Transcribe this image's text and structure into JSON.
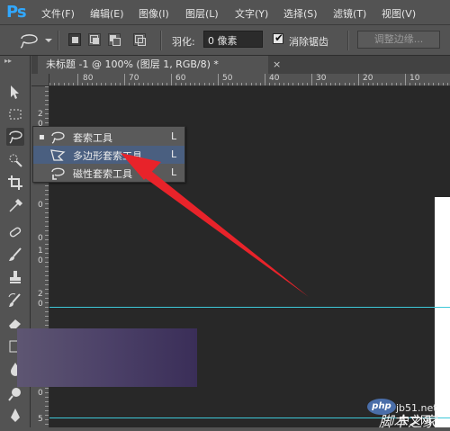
{
  "app": {
    "logo": "Ps"
  },
  "menu": [
    {
      "label": "文件(F)"
    },
    {
      "label": "编辑(E)"
    },
    {
      "label": "图像(I)"
    },
    {
      "label": "图层(L)"
    },
    {
      "label": "文字(Y)"
    },
    {
      "label": "选择(S)"
    },
    {
      "label": "滤镜(T)"
    },
    {
      "label": "视图(V)"
    }
  ],
  "options": {
    "feather_label": "羽化:",
    "feather_value": "0 像素",
    "antialias_label": "消除锯齿",
    "antialias_checked": true,
    "refine_label": "调整边缘...",
    "check_mark": "✔"
  },
  "document": {
    "tab_title": "未标题 -1 @ 100% (图层 1, RGB/8) *",
    "close_glyph": "×"
  },
  "ruler": {
    "top_labels": [
      "80",
      "70",
      "60",
      "50",
      "40",
      "30",
      "20",
      "10"
    ],
    "left_labels": [
      "2",
      "0",
      "1",
      "0",
      "0",
      "1",
      "0",
      "2",
      "0",
      "3",
      "0",
      "4",
      "0",
      "5"
    ]
  },
  "flyout": {
    "items": [
      {
        "icon": "lasso-icon",
        "label": "套索工具",
        "key": "L",
        "current": true
      },
      {
        "icon": "polygonal-lasso-icon",
        "label": "多边形套索工具",
        "key": "L",
        "highlighted": true
      },
      {
        "icon": "magnetic-lasso-icon",
        "label": "磁性套索工具",
        "key": "L"
      }
    ],
    "current_bullet": "▪"
  },
  "watermark": {
    "url": "jb51.net",
    "logo_text": "php",
    "site": "中文网",
    "script": "脚本之家"
  },
  "colors": {
    "guide": "#3ec8d8",
    "highlight": "#4a5f80",
    "arrow": "#e8232a",
    "ps_blue": "#31a8ff"
  }
}
